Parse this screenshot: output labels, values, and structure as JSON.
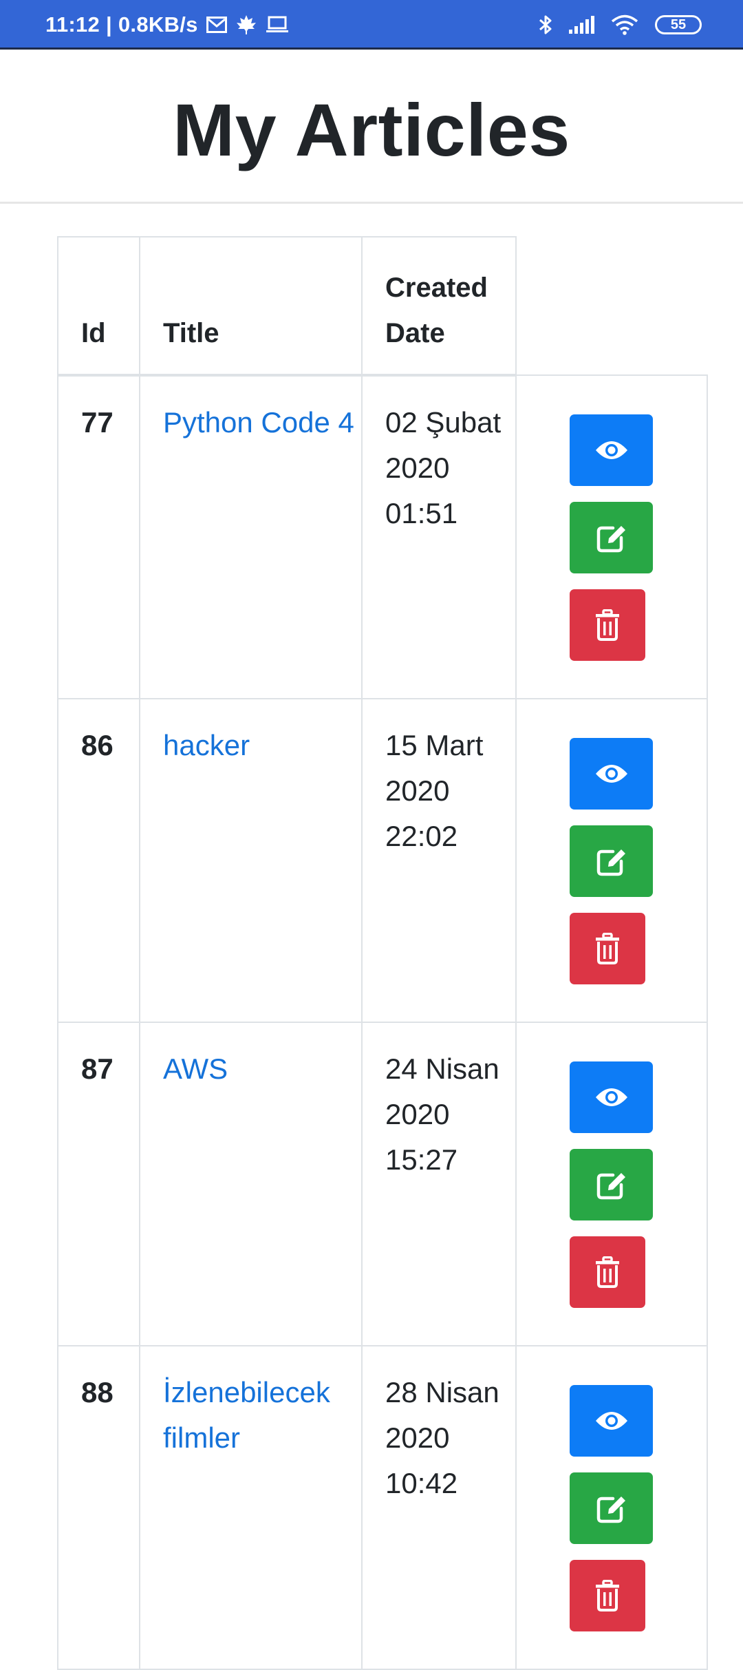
{
  "status_bar": {
    "time_speed": "11:12 | 0.8KB/s",
    "battery": "55",
    "icons": [
      "mail-icon",
      "maple-leaf-icon",
      "laptop-icon",
      "bluetooth-icon",
      "signal-icon",
      "wifi-icon",
      "battery-icon"
    ]
  },
  "header": {
    "title": "My Articles"
  },
  "table": {
    "columns": {
      "id": "Id",
      "title": "Title",
      "created_date": "Created Date"
    },
    "rows": [
      {
        "id": "77",
        "title": "Python Code 4",
        "date": "02 Şubat 2020 01:51"
      },
      {
        "id": "86",
        "title": "hacker",
        "date": "15 Mart 2020 22:02"
      },
      {
        "id": "87",
        "title": "AWS",
        "date": "24 Nisan 2020 15:27"
      },
      {
        "id": "88",
        "title": "İzlenebilecek filmler",
        "date": "28 Nisan 2020 10:42"
      }
    ],
    "actions": [
      "view",
      "edit",
      "delete"
    ],
    "icons": {
      "view": "eye-icon",
      "edit": "edit-icon",
      "delete": "trash-icon"
    }
  },
  "colors": {
    "status_bar": "#3366d6",
    "link": "#1572d9",
    "view_button": "#0d7cf6",
    "edit_button": "#28a745",
    "delete_button": "#dc3545",
    "border": "#dee2e6"
  }
}
